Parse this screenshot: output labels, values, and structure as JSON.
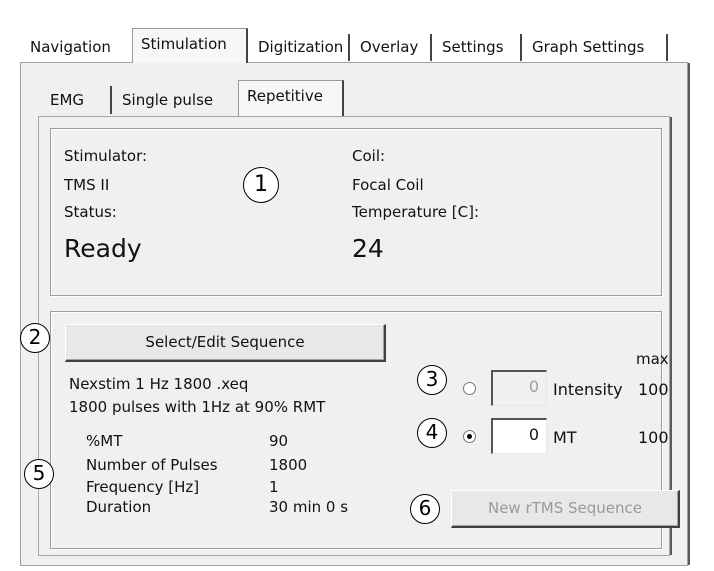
{
  "tabs": [
    {
      "label": "Navigation"
    },
    {
      "label": "Stimulation"
    },
    {
      "label": "Digitization"
    },
    {
      "label": "Overlay"
    },
    {
      "label": "Settings"
    },
    {
      "label": "Graph Settings"
    }
  ],
  "subtabs": [
    {
      "label": "EMG"
    },
    {
      "label": "Single pulse"
    },
    {
      "label": "Repetitive"
    }
  ],
  "status_panel": {
    "stimulator_label": "Stimulator:",
    "stimulator_value": "TMS II",
    "status_label": "Status:",
    "status_value": "Ready",
    "coil_label": "Coil:",
    "coil_value": "Focal Coil",
    "temperature_label": "Temperature [C]:",
    "temperature_value": "24"
  },
  "sequence_panel": {
    "select_button": "Select/Edit Sequence",
    "sequence_name": "Nexstim 1 Hz 1800 .xeq",
    "sequence_desc": "1800 pulses with 1Hz at 90% RMT",
    "params": [
      {
        "name": "%MT",
        "value": "90"
      },
      {
        "name": "Number of Pulses",
        "value": "1800"
      },
      {
        "name": "Frequency [Hz]",
        "value": "1"
      },
      {
        "name": "Duration",
        "value": "30 min 0 s"
      }
    ],
    "max_label": "max",
    "intensity": {
      "value": "0",
      "label": "Intensity",
      "max": "100",
      "selected": false
    },
    "mt": {
      "value": "0",
      "label": "MT",
      "max": "100",
      "selected": true
    },
    "new_button": "New rTMS Sequence"
  },
  "callouts": [
    "1",
    "2",
    "3",
    "4",
    "5",
    "6"
  ]
}
